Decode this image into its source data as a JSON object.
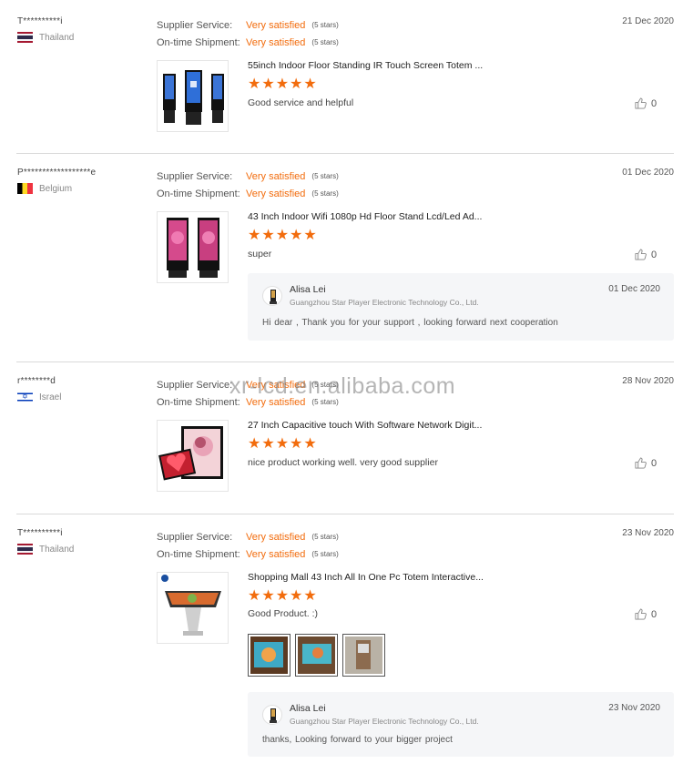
{
  "labels": {
    "supplier_service": "Supplier Service:",
    "ontime_shipment": "On-time Shipment:"
  },
  "watermark": "xr-lcd.en.alibaba.com",
  "reviews": [
    {
      "buyer": "T**********i",
      "country": "Thailand",
      "flag": "thailand-flag",
      "supplier_rating": "Very satisfied",
      "supplier_stars": "(5 stars)",
      "shipment_rating": "Very satisfied",
      "shipment_stars": "(5 stars)",
      "date": "21 Dec 2020",
      "product": "55inch Indoor Floor Standing IR Touch Screen Totem ...",
      "stars": "★★★★★",
      "comment": "Good service and helpful",
      "likes": "0"
    },
    {
      "buyer": "P******************e",
      "country": "Belgium",
      "flag": "belgium-flag",
      "supplier_rating": "Very satisfied",
      "supplier_stars": "(5 stars)",
      "shipment_rating": "Very satisfied",
      "shipment_stars": "(5 stars)",
      "date": "01 Dec 2020",
      "product": "43 Inch Indoor Wifi 1080p Hd Floor Stand Lcd/Led Ad...",
      "stars": "★★★★★",
      "comment": "super",
      "likes": "0",
      "reply": {
        "name": "Alisa Lei",
        "company": "Guangzhou Star Player Electronic Technology Co., Ltd.",
        "date": "01 Dec 2020",
        "text": "Hi  dear  , Thank  you  for your support , looking forward  next  cooperation"
      }
    },
    {
      "buyer": "r********d",
      "country": "Israel",
      "flag": "israel-flag",
      "supplier_rating": "Very satisfied",
      "supplier_stars": "(5 stars)",
      "shipment_rating": "Very satisfied",
      "shipment_stars": "(5 stars)",
      "date": "28 Nov 2020",
      "product": "27 Inch Capacitive touch With Software Network Digit...",
      "stars": "★★★★★",
      "comment": "nice product working well. very good supplier",
      "likes": "0"
    },
    {
      "buyer": "T**********i",
      "country": "Thailand",
      "flag": "thailand-flag",
      "supplier_rating": "Very satisfied",
      "supplier_stars": "(5 stars)",
      "shipment_rating": "Very satisfied",
      "shipment_stars": "(5 stars)",
      "date": "23 Nov 2020",
      "product": "Shopping Mall 43 Inch All In One Pc Totem Interactive...",
      "stars": "★★★★★",
      "comment": "Good Product. :)",
      "likes": "0",
      "reply": {
        "name": "Alisa Lei",
        "company": "Guangzhou Star Player Electronic Technology Co., Ltd.",
        "date": "23 Nov 2020",
        "text": "thanks,  Looking forward to your bigger project"
      }
    }
  ],
  "colors": {
    "accent": "#f26c0d",
    "divider": "#d9d9d9",
    "reply_bg": "#f5f6f8"
  }
}
